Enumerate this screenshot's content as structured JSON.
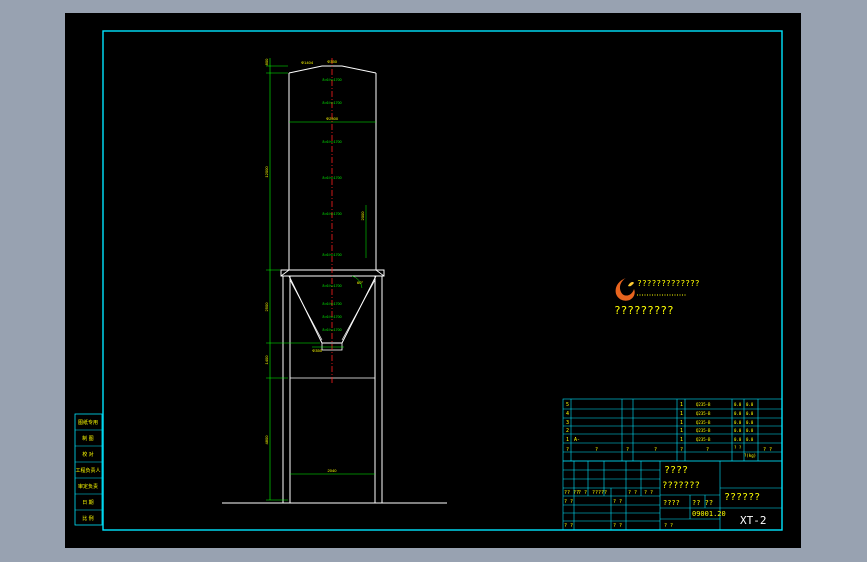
{
  "side_stamps": [
    "图纸专用",
    "制 图",
    "校 对",
    "工程负责人",
    "审定负责",
    "日 期",
    "比 例"
  ],
  "dims": {
    "vertical": [
      "800",
      "12000",
      "2500",
      "1400",
      "4800"
    ],
    "top_diameter": "Φ1404",
    "top_small": "Φ350",
    "shell_diameter": "Φ2500",
    "bottom_outlet": "Φ350",
    "base_width": "2040",
    "right_dim": "2000",
    "angle": "60°"
  },
  "course_labels": [
    "δ=6 h=1700",
    "δ=6 h=1700",
    "δ=6 h=1700",
    "δ=6 h=1700",
    "δ=6 h=1700",
    "δ=6 h=1700",
    "δ=6 h=1700",
    "δ=6 h=1700",
    "δ=6 h=1700",
    "δ=6 h=1700"
  ],
  "logo": {
    "line1": "?????????????",
    "line2": "?????????"
  },
  "parts_table": {
    "rows": [
      {
        "no": "5",
        "name": "",
        "material": "Q235-B",
        "qty": "1",
        "w1": "0.0",
        "w2": "0.0"
      },
      {
        "no": "4",
        "name": "",
        "material": "Q235-B",
        "qty": "1",
        "w1": "0.0",
        "w2": "0.0"
      },
      {
        "no": "3",
        "name": "",
        "material": "Q235-B",
        "qty": "1",
        "w1": "0.0",
        "w2": "0.0"
      },
      {
        "no": "2",
        "name": "",
        "material": "Q235-B",
        "qty": "1",
        "w1": "0.0",
        "w2": "0.0"
      },
      {
        "no": "1",
        "name": "A-",
        "material": "Q235-B",
        "qty": "1",
        "w1": "0.0",
        "w2": "0.0"
      }
    ],
    "header": [
      "?",
      "?",
      "?",
      "?",
      "?",
      "?",
      "? ?",
      "?(kg)",
      "? ?"
    ]
  },
  "title_block": {
    "project": "????",
    "drawing_name": "???????",
    "company": "??????",
    "scale_label": "????",
    "sheet_label": "?? ??",
    "date": "09001.20",
    "drawing_no": "XT-2",
    "sign_labels": [
      "?? ??",
      "? ?",
      "?????",
      "? ?",
      "? ?",
      "? ?",
      "? ?"
    ],
    "bottom_labels": [
      "? ?",
      "? ?",
      "? ?"
    ]
  }
}
